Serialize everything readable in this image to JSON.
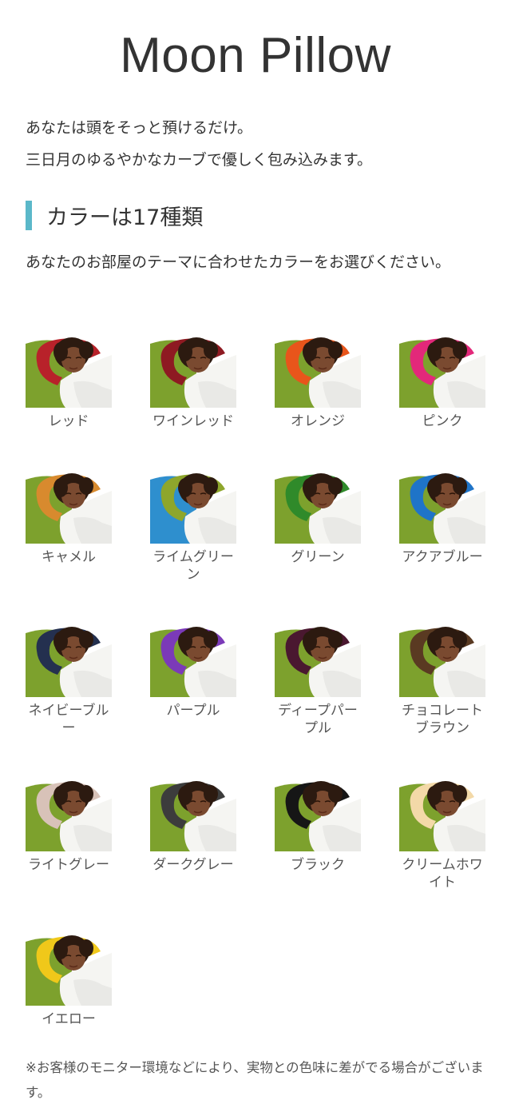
{
  "header": {
    "title": "Moon Pillow"
  },
  "intro": {
    "line1": "あなたは頭をそっと預けるだけ。",
    "line2": "三日月のゆるやかなカーブで優しく包み込みます。"
  },
  "colors_section": {
    "heading": "カラーは17種類",
    "description": "あなたのお部屋のテーマに合わせたカラーをお選びください。",
    "items": [
      {
        "label": "レッド",
        "color": "#b8222a"
      },
      {
        "label": "ワインレッド",
        "color": "#8e1a22"
      },
      {
        "label": "オレンジ",
        "color": "#e8551b"
      },
      {
        "label": "ピンク",
        "color": "#e3287a"
      },
      {
        "label": "キャメル",
        "color": "#d88a2e"
      },
      {
        "label": "ライムグリーン",
        "color": "#8ea62c"
      },
      {
        "label": "グリーン",
        "color": "#2f8a2a"
      },
      {
        "label": "アクアブルー",
        "color": "#1f74c8"
      },
      {
        "label": "ネイビーブルー",
        "color": "#24304f"
      },
      {
        "label": "パープル",
        "color": "#7b3ab8"
      },
      {
        "label": "ディープパープル",
        "color": "#4a1830"
      },
      {
        "label": "チョコレートブラウン",
        "color": "#5a3a22"
      },
      {
        "label": "ライトグレー",
        "color": "#d8c2b8"
      },
      {
        "label": "ダークグレー",
        "color": "#3c3c3c"
      },
      {
        "label": "ブラック",
        "color": "#161616"
      },
      {
        "label": "クリームホワイト",
        "color": "#f3d9a8"
      },
      {
        "label": "イエロー",
        "color": "#f0c81a"
      }
    ],
    "background_colors": {
      "cushion": "#7da12d",
      "aqua_cushion": "#2f8fce",
      "skin": "#7a4a30",
      "hair": "#2c1a10",
      "shirt": "#f5f5f2"
    }
  },
  "footnote": "※お客様のモニター環境などにより、実物との色味に差がでる場合がございます。",
  "accent_color": "#5bb8c9"
}
